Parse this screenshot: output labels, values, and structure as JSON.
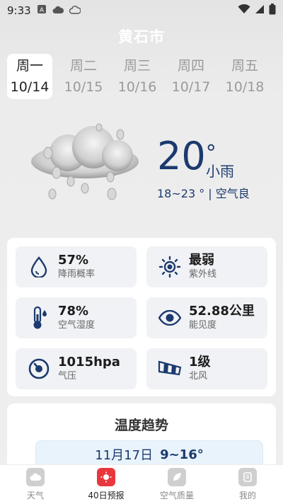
{
  "status_bar": {
    "time": "9:33"
  },
  "header": {
    "city": "黄石市"
  },
  "days": [
    {
      "weekday": "周一",
      "date": "10/14",
      "active": true
    },
    {
      "weekday": "周二",
      "date": "10/15",
      "active": false
    },
    {
      "weekday": "周三",
      "date": "10/16",
      "active": false
    },
    {
      "weekday": "周四",
      "date": "10/17",
      "active": false
    },
    {
      "weekday": "周五",
      "date": "10/18",
      "active": false
    }
  ],
  "current": {
    "temp": "20",
    "degree_symbol": "°",
    "condition": "小雨",
    "range": "18~23 ° | 空气良"
  },
  "details": [
    {
      "value": "57%",
      "label": "降雨概率",
      "icon": "raindrop-icon"
    },
    {
      "value": "最弱",
      "label": "紫外线",
      "icon": "sun-icon"
    },
    {
      "value": "78%",
      "label": "空气湿度",
      "icon": "thermometer-icon"
    },
    {
      "value": "52.88公里",
      "label": "能见度",
      "icon": "eye-icon"
    },
    {
      "value": "1015hpa",
      "label": "气压",
      "icon": "pressure-gauge-icon"
    },
    {
      "value": "1级",
      "label": "北风",
      "icon": "windsock-icon"
    }
  ],
  "trend": {
    "title": "温度趋势",
    "first_row": {
      "date": "11月17日",
      "range": "9~16°"
    }
  },
  "tabbar": [
    {
      "label": "天气",
      "active": false
    },
    {
      "label": "40日预报",
      "active": true
    },
    {
      "label": "空气质量",
      "active": false
    },
    {
      "label": "我的",
      "active": false
    }
  ],
  "colors": {
    "accent": "#1c3a6e",
    "tab_active": "#e8383d"
  }
}
